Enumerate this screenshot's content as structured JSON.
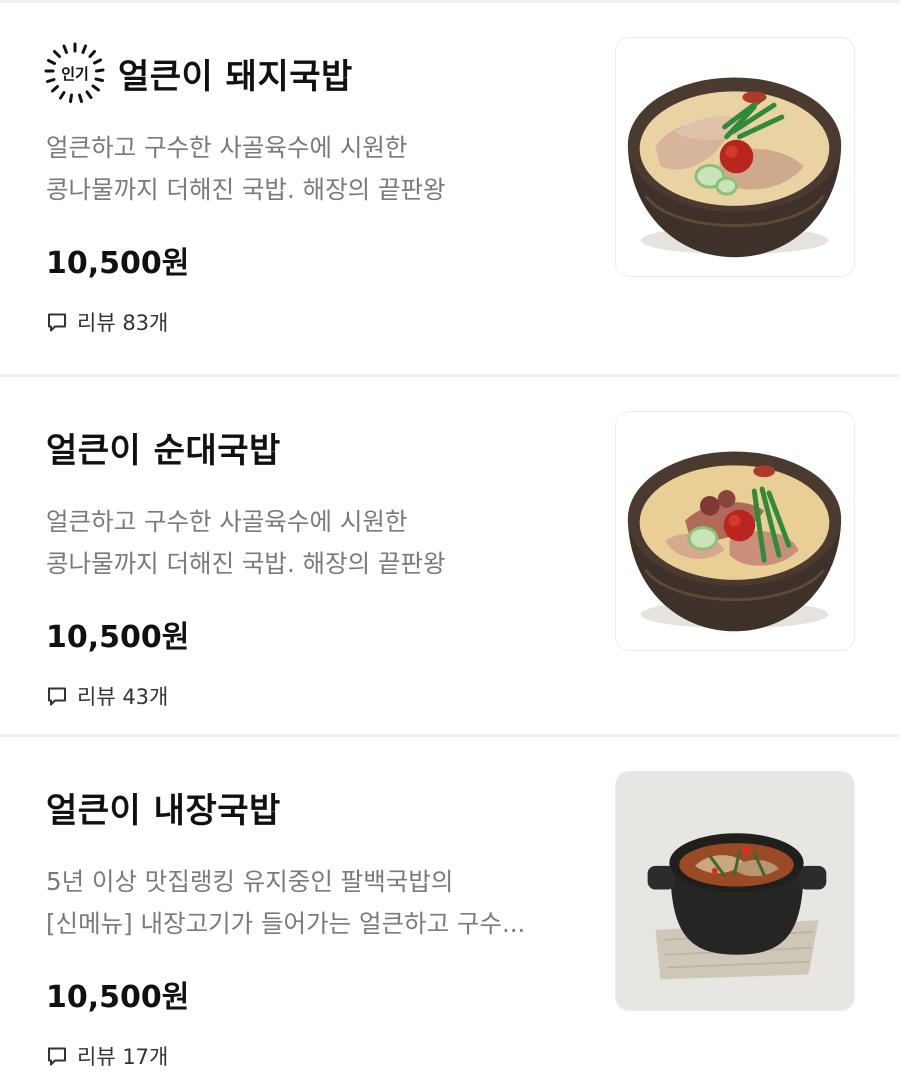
{
  "menu_items": [
    {
      "badge": "인기",
      "title": "얼큰이 돼지국밥",
      "desc_line1": "얼큰하고 구수한 사골육수에 시원한",
      "desc_line2": "콩나물까지 더해진 국밥. 해장의 끝판왕",
      "price": "10,500원",
      "review": "리뷰 83개",
      "image_icon": "pork-soup-bowl-photo"
    },
    {
      "title": "얼큰이 순대국밥",
      "desc_line1": "얼큰하고 구수한 사골육수에 시원한",
      "desc_line2": "콩나물까지 더해진 국밥. 해장의 끝판왕",
      "price": "10,500원",
      "review": "리뷰 43개",
      "image_icon": "sundae-soup-bowl-photo"
    },
    {
      "title": "얼큰이 내장국밥",
      "desc_line1": "5년 이상 맛집랭킹 유지중인 팔백국밥의",
      "desc_line2": "[신메뉴] 내장고기가 들어가는 얼큰하고 구수...",
      "price": "10,500원",
      "review": "리뷰 17개",
      "image_icon": "offal-soup-pot-photo"
    }
  ],
  "colors": {
    "title": "#111111",
    "description": "#7a7a7a",
    "divider": "#f1f1f3",
    "broth": "#e9cf9a",
    "bowl": "#4a3a30"
  }
}
